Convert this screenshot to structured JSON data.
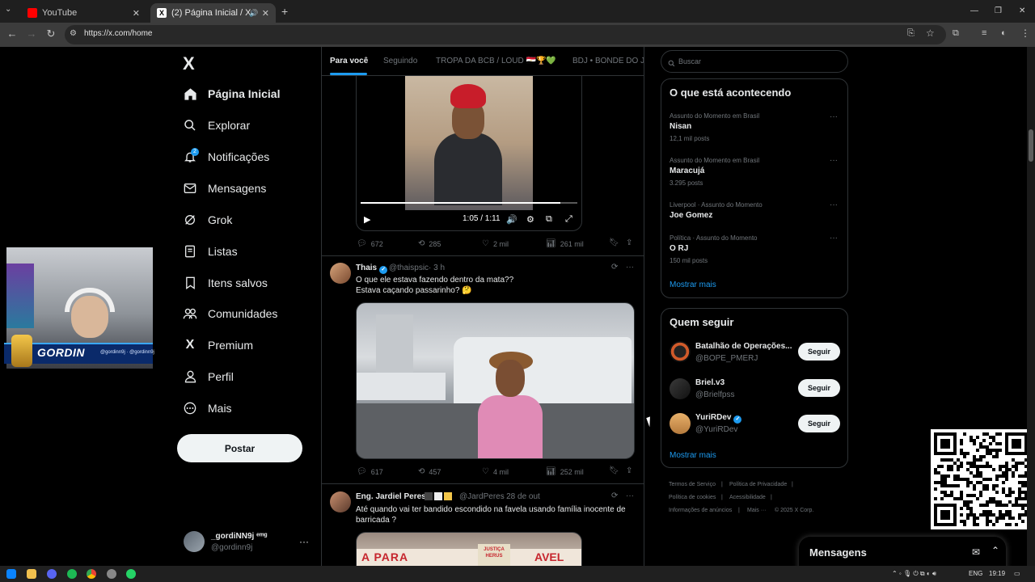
{
  "browser": {
    "tabs": [
      {
        "label": "YouTube",
        "favicon_color": "#ff0000"
      },
      {
        "label": "(2) Página Inicial / X",
        "favicon_color": "#ffffff"
      }
    ],
    "url": "https://x.com/home"
  },
  "sidebar": {
    "logo": "X",
    "items": [
      {
        "label": "Página Inicial",
        "icon": "home-icon"
      },
      {
        "label": "Explorar",
        "icon": "search-icon"
      },
      {
        "label": "Notificações",
        "icon": "bell-icon"
      },
      {
        "label": "Mensagens",
        "icon": "envelope-icon"
      },
      {
        "label": "Grok",
        "icon": "grok-icon"
      },
      {
        "label": "Listas",
        "icon": "list-icon"
      },
      {
        "label": "Itens salvos",
        "icon": "bookmark-icon"
      },
      {
        "label": "Comunidades",
        "icon": "people-icon"
      },
      {
        "label": "Premium",
        "icon": "x-premium-icon"
      },
      {
        "label": "Perfil",
        "icon": "person-icon"
      },
      {
        "label": "Mais",
        "icon": "more-circle-icon"
      }
    ],
    "notification_badge": "2",
    "post_button": "Postar",
    "profile": {
      "name": "_gordiNN9j ᵉᵐᵍ",
      "handle": "@gordinn9j"
    }
  },
  "webcam": {
    "name": "GORDIN",
    "tag": "@gordinn9j · @gordinn9j"
  },
  "feed_tabs": [
    "Para você",
    "Seguindo",
    "TROPA DA BCB / LOUD 🇪🇬🏆💚",
    "BDJ • BONDE DO JO"
  ],
  "video_post": {
    "time": "1:05 / 1:11",
    "progress": 0.92,
    "actions": {
      "replies": "672",
      "reposts": "285",
      "likes": "2 mil",
      "views": "261 mil"
    }
  },
  "tweet2": {
    "name": "Thais",
    "handle": "@thaispsic",
    "time": "· 3 h",
    "text_line1": "O que ele estava fazendo dentro da mata??",
    "text_line2": "Estava caçando passarinho? 🤔",
    "actions": {
      "replies": "617",
      "reposts": "457",
      "likes": "4 mil",
      "views": "252 mil"
    }
  },
  "tweet3": {
    "name": "Eng. Jardiel Peres",
    "handle": "@JardPeres",
    "time": "· 28 de out",
    "text_line1": "Até quando vai ter bandido escondido na favela usando família inocente de",
    "text_line2": "barricada ?",
    "image_text_left": "A PARA",
    "image_text_right": "AVEL",
    "image_sign": "JUSTIÇA HERUS"
  },
  "search": {
    "placeholder": "Buscar"
  },
  "trends": {
    "title": "O que está acontecendo",
    "items": [
      {
        "context": "Assunto do Momento em Brasil",
        "name": "Nisan",
        "count": "12,1 mil posts"
      },
      {
        "context": "Assunto do Momento em Brasil",
        "name": "Maracujá",
        "count": "3.295 posts"
      },
      {
        "context": "Liverpool · Assunto do Momento",
        "name": "Joe Gomez",
        "count": ""
      },
      {
        "context": "Política · Assunto do Momento",
        "name": "O RJ",
        "count": "150 mil posts"
      }
    ],
    "show_more": "Mostrar mais"
  },
  "who_to_follow": {
    "title": "Quem seguir",
    "items": [
      {
        "name": "Batalhão de Operações...",
        "handle": "@BOPE_PMERJ",
        "button": "Seguir"
      },
      {
        "name": "Briel.v3",
        "handle": "@Brielfpss",
        "button": "Seguir"
      },
      {
        "name": "YuriRDev",
        "handle": "@YuriRDev",
        "button": "Seguir"
      }
    ],
    "show_more": "Mostrar mais"
  },
  "footer": {
    "terms": "Termos de Serviço",
    "privacy": "Política de Privacidade",
    "cookies": "Política de cookies",
    "accessibility": "Acessibilidade",
    "ads": "Informações de anúncios",
    "more": "Mais ···",
    "copyright": "© 2025 X Corp."
  },
  "messages_drawer": {
    "title": "Mensagens"
  },
  "taskbar": {
    "lang": "ENG",
    "time": "19:19"
  },
  "colors": {
    "accent": "#1d9bf0",
    "background": "#000000",
    "border": "#2f3336",
    "muted": "#71767b"
  }
}
